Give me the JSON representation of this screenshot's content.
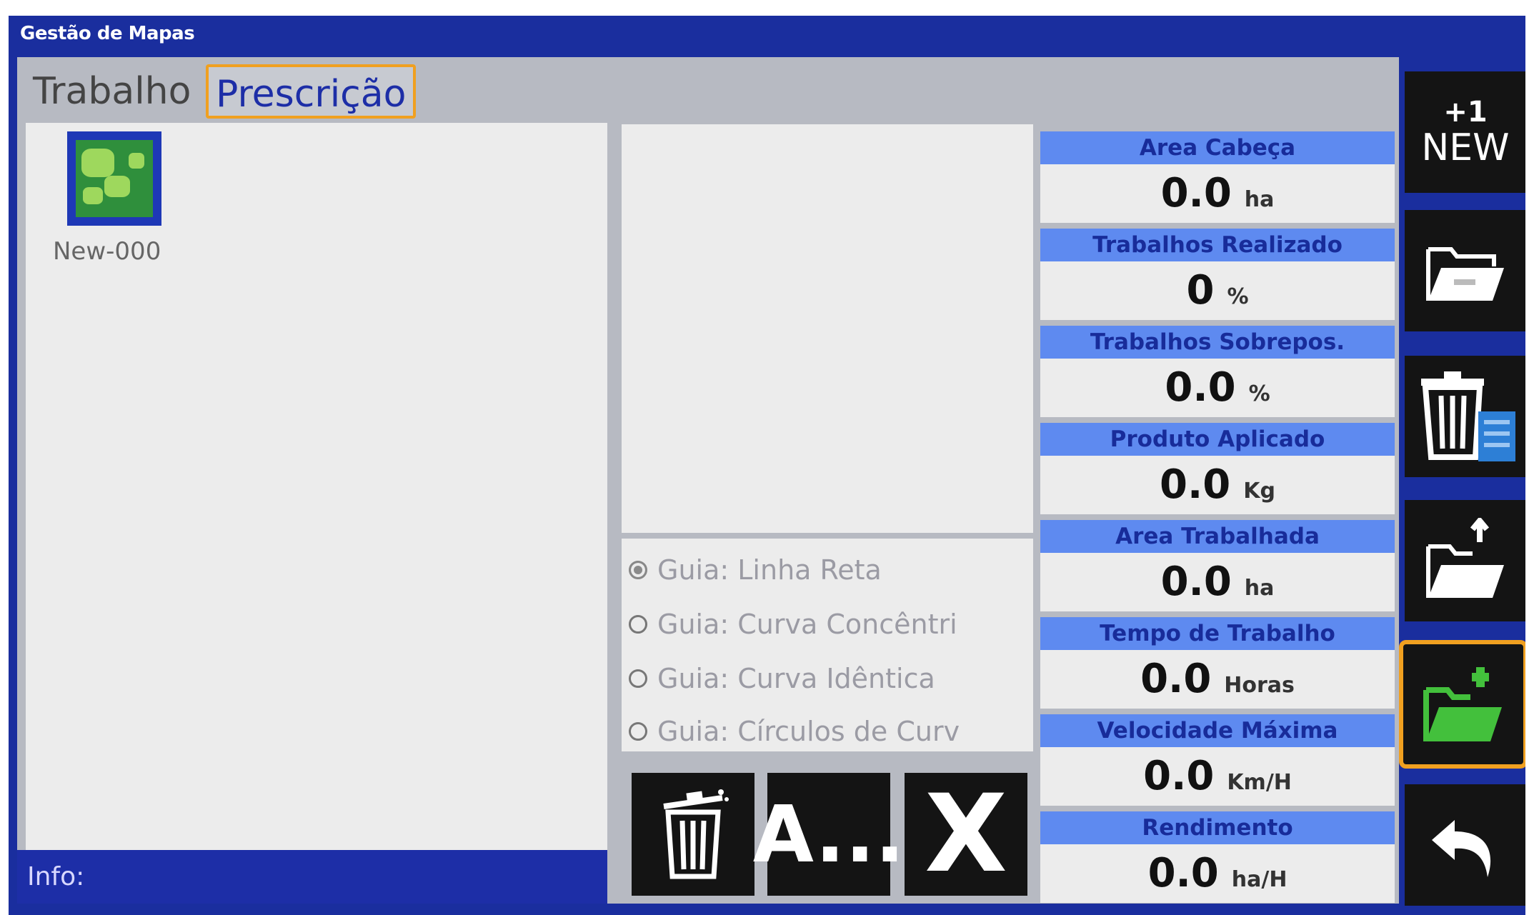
{
  "window": {
    "title": "Gestão de Mapas"
  },
  "tabs": [
    {
      "label": "Trabalho",
      "active": false
    },
    {
      "label": "Prescrição",
      "active": true
    }
  ],
  "map_list": {
    "items": [
      {
        "label": "New-000",
        "icon": "map-icon"
      }
    ]
  },
  "info_bar": {
    "label": "Info:"
  },
  "guides": [
    {
      "label": "Guia: Linha Reta",
      "checked": true
    },
    {
      "label": "Guia: Curva Concêntri",
      "checked": false
    },
    {
      "label": "Guia: Curva Idêntica",
      "checked": false
    },
    {
      "label": "Guia: Círculos de Curv",
      "checked": false
    }
  ],
  "tools": {
    "delete_icon": "trash-icon",
    "rename_label": "A...",
    "close_label": "X"
  },
  "stats": [
    {
      "title": "Area Cabeça",
      "value": "0.0",
      "unit": "ha"
    },
    {
      "title": "Trabalhos Realizado",
      "value": "0",
      "unit": "%"
    },
    {
      "title": "Trabalhos Sobrepos.",
      "value": "0.0",
      "unit": "%"
    },
    {
      "title": "Produto Aplicado",
      "value": "0.0",
      "unit": "Kg"
    },
    {
      "title": "Area Trabalhada",
      "value": "0.0",
      "unit": "ha"
    },
    {
      "title": "Tempo de Trabalho",
      "value": "0.0",
      "unit": "Horas"
    },
    {
      "title": "Velocidade Máxima",
      "value": "0.0",
      "unit": "Km/H"
    },
    {
      "title": "Rendimento",
      "value": "0.0",
      "unit": "ha/H"
    }
  ],
  "side_buttons": {
    "new_plus": "+1",
    "new_label": "NEW",
    "icons": [
      "folder-open-icon",
      "trash-list-icon",
      "folder-upload-icon",
      "folder-add-icon",
      "back-arrow-icon"
    ]
  },
  "colors": {
    "frame": "#1a2e9e",
    "stat_header": "#5e8af0",
    "highlight": "#f0a020",
    "folder_green": "#43c03c"
  }
}
